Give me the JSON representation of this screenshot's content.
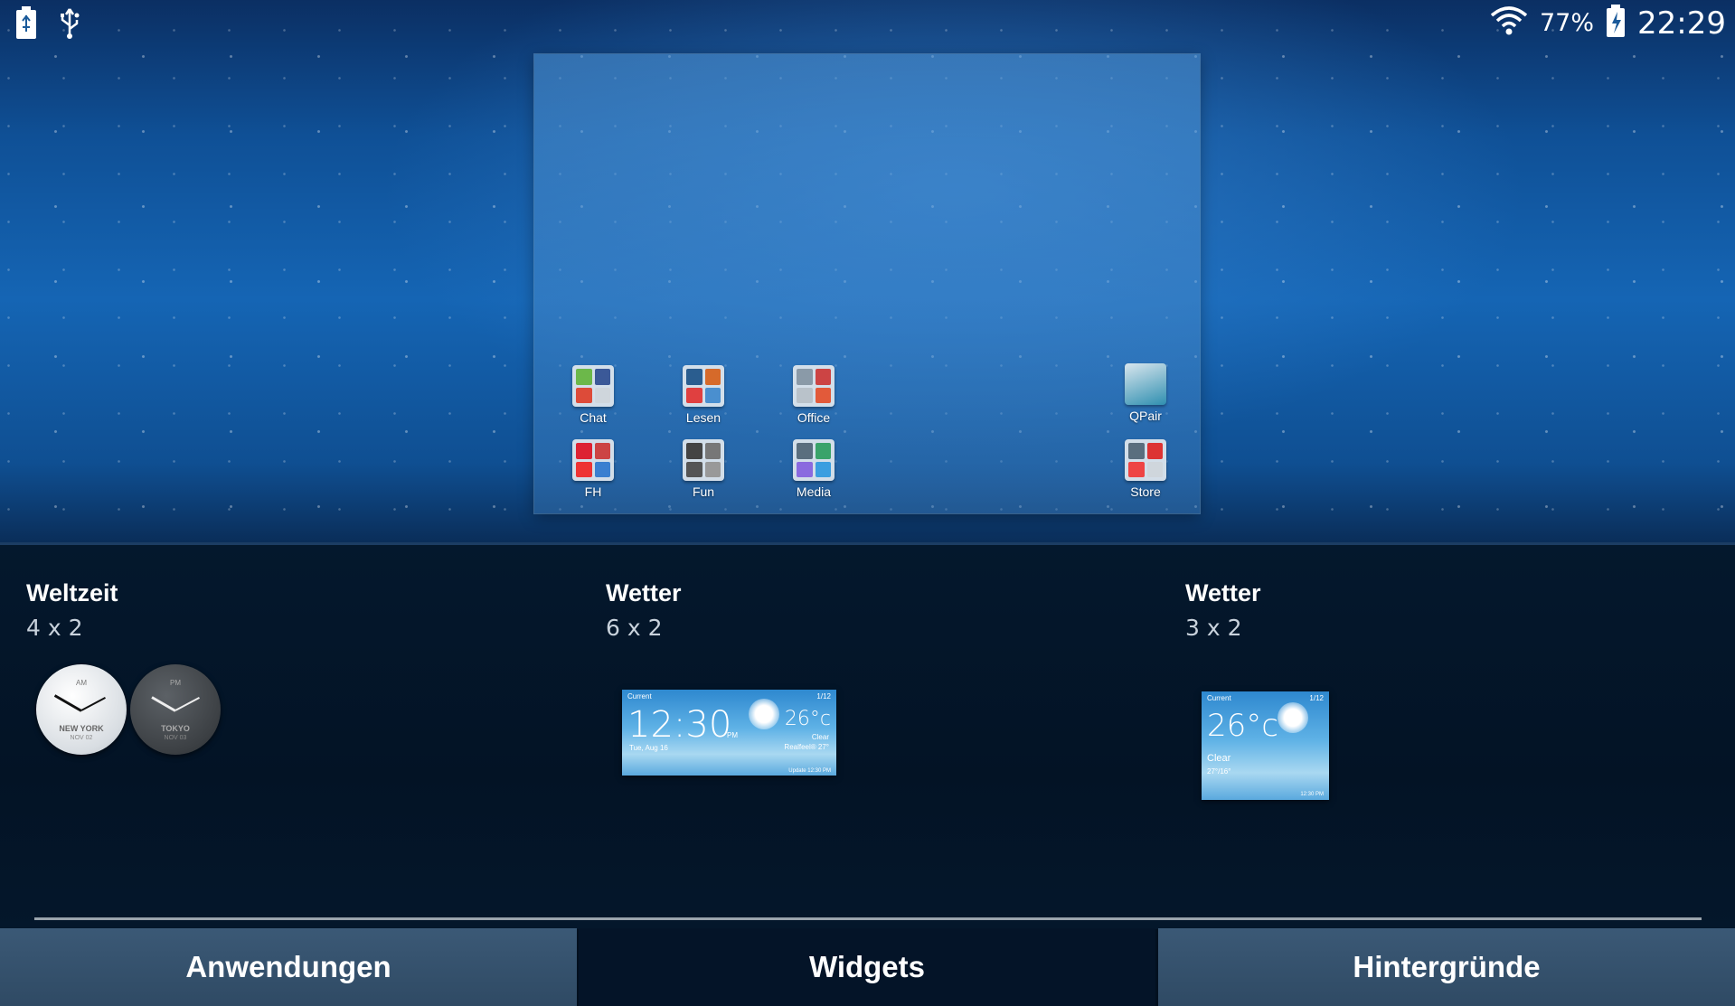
{
  "status_bar": {
    "left_icons": [
      "battery-usb-icon",
      "usb-icon"
    ],
    "wifi_icon": "wifi-icon",
    "battery_percent": "77%",
    "battery_icon": "battery-charging-icon",
    "time": "22:29"
  },
  "preview": {
    "apps": [
      {
        "label": "Chat",
        "icon": "chat-folder-icon"
      },
      {
        "label": "Lesen",
        "icon": "lesen-folder-icon"
      },
      {
        "label": "Office",
        "icon": "office-folder-icon"
      },
      {
        "label": "QPair",
        "icon": "qpair-icon"
      },
      {
        "label": "FH",
        "icon": "fh-folder-icon"
      },
      {
        "label": "Fun",
        "icon": "fun-folder-icon"
      },
      {
        "label": "Media",
        "icon": "media-folder-icon"
      },
      {
        "label": "Store",
        "icon": "store-folder-icon"
      }
    ]
  },
  "widgets": [
    {
      "title": "Weltzeit",
      "size": "4 x 2",
      "clocks": [
        {
          "ampm": "AM",
          "city": "NEW YORK",
          "date": "NOV 02"
        },
        {
          "ampm": "PM",
          "city": "TOKYO",
          "date": "NOV 03"
        }
      ]
    },
    {
      "title": "Wetter",
      "size": "6 x 2",
      "preview": {
        "location": "Current",
        "page": "1/12",
        "time": "12:30",
        "suffix": "PM",
        "date": "Tue, Aug 16",
        "temp": "26°c",
        "condition": "Clear",
        "minmax": "Realfeel® 27°",
        "updated": "Update 12:30 PM"
      }
    },
    {
      "title": "Wetter",
      "size": "3 x 2",
      "preview": {
        "location": "Current",
        "page": "1/12",
        "temp": "26°c",
        "condition": "Clear",
        "minmax": "27°/16°",
        "updated": "12:30 PM"
      }
    }
  ],
  "tabs": [
    {
      "label": "Anwendungen",
      "active": false
    },
    {
      "label": "Widgets",
      "active": true
    },
    {
      "label": "Hintergründe",
      "active": false
    }
  ],
  "colors": {
    "tab_inactive": "#33506b",
    "tab_active": "#041428",
    "panel": "#031325",
    "wallpaper": "#1565b4"
  }
}
